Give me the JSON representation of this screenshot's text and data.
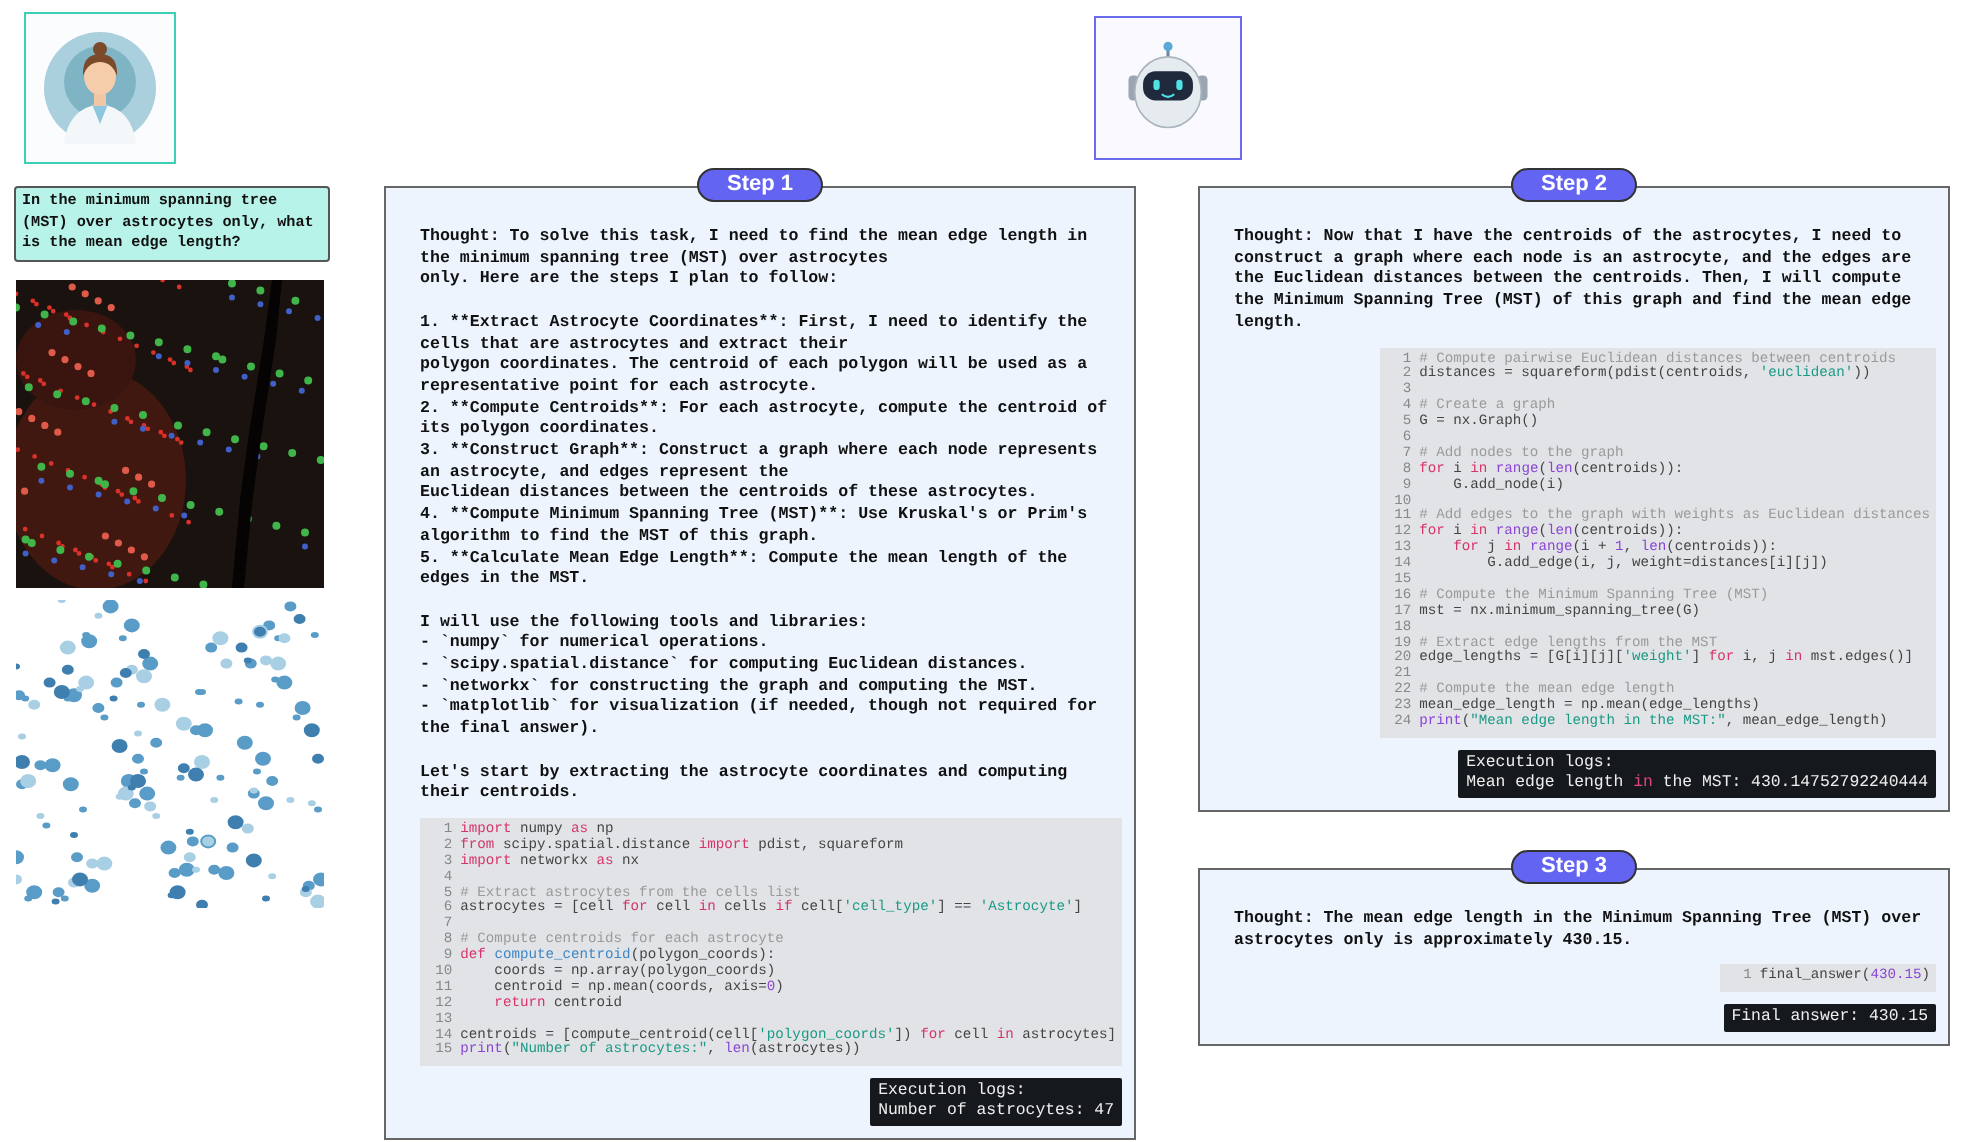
{
  "question": "In the minimum spanning tree (MST) over astrocytes only, what is the mean edge length?",
  "steps": [
    {
      "label": "Step 1",
      "thought": [
        [
          "Thought: To solve this task, I need to find the mean edge length in",
          "the minimum spanning tree (MST) over astrocytes",
          "only. Here are the steps I plan to follow:"
        ],
        [
          "1. **Extract Astrocyte Coordinates**: First, I need to identify the",
          "cells that are astrocytes and extract their",
          "polygon coordinates. The centroid of each polygon will be used as a",
          "representative point for each astrocyte.",
          "2. **Compute Centroids**: For each astrocyte, compute the centroid of",
          "its polygon coordinates.",
          "3. **Construct Graph**: Construct a graph where each node represents",
          "an astrocyte, and edges represent the",
          "Euclidean distances between the centroids of these astrocytes.",
          "4. **Compute Minimum Spanning Tree (MST)**: Use Kruskal's or Prim's",
          "algorithm to find the MST of this graph.",
          "5. **Calculate Mean Edge Length**: Compute the mean length of the",
          "edges in the MST."
        ],
        [
          "I will use the following tools and libraries:",
          "- `numpy` for numerical operations.",
          "- `scipy.spatial.distance` for computing Euclidean distances.",
          "- `networkx` for constructing the graph and computing the MST.",
          "- `matplotlib` for visualization (if needed, though not required for",
          "the final answer)."
        ],
        [
          "Let's start by extracting the astrocyte coordinates and computing",
          "their centroids."
        ]
      ],
      "code": [
        {
          "number": "1",
          "tokens": [
            {
              "text": "import",
              "kind": "keyword"
            },
            {
              "text": " numpy ",
              "kind": "plain"
            },
            {
              "text": "as",
              "kind": "keyword"
            },
            {
              "text": " np",
              "kind": "plain"
            }
          ]
        },
        {
          "number": "2",
          "tokens": [
            {
              "text": "from",
              "kind": "keyword"
            },
            {
              "text": " scipy.spatial.distance ",
              "kind": "plain"
            },
            {
              "text": "import",
              "kind": "keyword"
            },
            {
              "text": " pdist, squareform",
              "kind": "plain"
            }
          ]
        },
        {
          "number": "3",
          "tokens": [
            {
              "text": "import",
              "kind": "keyword"
            },
            {
              "text": " networkx ",
              "kind": "plain"
            },
            {
              "text": "as",
              "kind": "keyword"
            },
            {
              "text": " nx",
              "kind": "plain"
            }
          ]
        },
        {
          "number": "4"
        },
        {
          "number": "5",
          "tokens": [
            {
              "text": "# Extract astrocytes from the cells list",
              "kind": "comment"
            }
          ]
        },
        {
          "number": "6",
          "tokens": [
            {
              "text": "astrocytes = [cell ",
              "kind": "plain"
            },
            {
              "text": "for",
              "kind": "keyword"
            },
            {
              "text": " cell ",
              "kind": "plain"
            },
            {
              "text": "in",
              "kind": "keyword"
            },
            {
              "text": " cells ",
              "kind": "plain"
            },
            {
              "text": "if",
              "kind": "keyword"
            },
            {
              "text": " cell[",
              "kind": "plain"
            },
            {
              "text": "'cell_type'",
              "kind": "string"
            },
            {
              "text": "] == ",
              "kind": "plain"
            },
            {
              "text": "'Astrocyte'",
              "kind": "string"
            },
            {
              "text": "]",
              "kind": "plain"
            }
          ]
        },
        {
          "number": "7"
        },
        {
          "number": "8",
          "tokens": [
            {
              "text": "# Compute centroids for each astrocyte",
              "kind": "comment"
            }
          ]
        },
        {
          "number": "9",
          "tokens": [
            {
              "text": "def ",
              "kind": "keyword"
            },
            {
              "text": "compute_centroid",
              "kind": "function"
            },
            {
              "text": "(polygon_coords):",
              "kind": "plain"
            }
          ]
        },
        {
          "number": "10",
          "tokens": [
            {
              "text": "    coords = np.array(polygon_coords)",
              "kind": "plain"
            }
          ]
        },
        {
          "number": "11",
          "tokens": [
            {
              "text": "    centroid = np.mean(coords, axis=",
              "kind": "plain"
            },
            {
              "text": "0",
              "kind": "number"
            },
            {
              "text": ")",
              "kind": "plain"
            }
          ]
        },
        {
          "number": "12",
          "tokens": [
            {
              "text": "    return",
              "kind": "keyword"
            },
            {
              "text": " centroid",
              "kind": "plain"
            }
          ]
        },
        {
          "number": "13"
        },
        {
          "number": "14",
          "tokens": [
            {
              "text": "centroids = [compute_centroid(cell[",
              "kind": "plain"
            },
            {
              "text": "'polygon_coords'",
              "kind": "string"
            },
            {
              "text": "]) ",
              "kind": "plain"
            },
            {
              "text": "for",
              "kind": "keyword"
            },
            {
              "text": " cell ",
              "kind": "plain"
            },
            {
              "text": "in",
              "kind": "keyword"
            },
            {
              "text": " astrocytes]",
              "kind": "plain"
            }
          ]
        },
        {
          "number": "15",
          "tokens": [
            {
              "text": "print",
              "kind": "builtin"
            },
            {
              "text": "(",
              "kind": "plain"
            },
            {
              "text": "\"Number of astrocytes:\"",
              "kind": "string"
            },
            {
              "text": ", ",
              "kind": "plain"
            },
            {
              "text": "len",
              "kind": "builtin"
            },
            {
              "text": "(astrocytes))",
              "kind": "plain"
            }
          ]
        }
      ],
      "log": [
        [
          {
            "text": "Execution logs:",
            "kind": "plain"
          }
        ],
        [
          {
            "text": "Number of astrocytes: 47",
            "kind": "plain"
          }
        ]
      ]
    },
    {
      "label": "Step 2",
      "thought": [
        [
          "Thought: Now that I have the centroids of the astrocytes, I need to",
          "construct a graph where each node is an astrocyte, and the edges are",
          "the Euclidean distances between the centroids. Then, I will compute",
          "the Minimum Spanning Tree (MST) of this graph and find the mean edge",
          "length."
        ]
      ],
      "code": [
        {
          "number": "1",
          "tokens": [
            {
              "text": "# Compute pairwise Euclidean distances between centroids",
              "kind": "comment"
            }
          ]
        },
        {
          "number": "2",
          "tokens": [
            {
              "text": "distances = squareform(pdist(centroids, ",
              "kind": "plain"
            },
            {
              "text": "'euclidean'",
              "kind": "string"
            },
            {
              "text": "))",
              "kind": "plain"
            }
          ]
        },
        {
          "number": "3"
        },
        {
          "number": "4",
          "tokens": [
            {
              "text": "# Create a graph",
              "kind": "comment"
            }
          ]
        },
        {
          "number": "5",
          "tokens": [
            {
              "text": "G = nx.Graph()",
              "kind": "plain"
            }
          ]
        },
        {
          "number": "6"
        },
        {
          "number": "7",
          "tokens": [
            {
              "text": "# Add nodes to the graph",
              "kind": "comment"
            }
          ]
        },
        {
          "number": "8",
          "tokens": [
            {
              "text": "for",
              "kind": "keyword"
            },
            {
              "text": " i ",
              "kind": "plain"
            },
            {
              "text": "in ",
              "kind": "keyword"
            },
            {
              "text": "range",
              "kind": "builtin"
            },
            {
              "text": "(",
              "kind": "plain"
            },
            {
              "text": "len",
              "kind": "builtin"
            },
            {
              "text": "(centroids)):",
              "kind": "plain"
            }
          ]
        },
        {
          "number": "9",
          "tokens": [
            {
              "text": "    G.add_node(i)",
              "kind": "plain"
            }
          ]
        },
        {
          "number": "10"
        },
        {
          "number": "11",
          "tokens": [
            {
              "text": "# Add edges to the graph with weights as Euclidean distances",
              "kind": "comment"
            }
          ]
        },
        {
          "number": "12",
          "tokens": [
            {
              "text": "for",
              "kind": "keyword"
            },
            {
              "text": " i ",
              "kind": "plain"
            },
            {
              "text": "in ",
              "kind": "keyword"
            },
            {
              "text": "range",
              "kind": "builtin"
            },
            {
              "text": "(",
              "kind": "plain"
            },
            {
              "text": "len",
              "kind": "builtin"
            },
            {
              "text": "(centroids)):",
              "kind": "plain"
            }
          ]
        },
        {
          "number": "13",
          "tokens": [
            {
              "text": "    for",
              "kind": "keyword"
            },
            {
              "text": " j ",
              "kind": "plain"
            },
            {
              "text": "in ",
              "kind": "keyword"
            },
            {
              "text": "range",
              "kind": "builtin"
            },
            {
              "text": "(i + ",
              "kind": "plain"
            },
            {
              "text": "1",
              "kind": "number"
            },
            {
              "text": ", ",
              "kind": "plain"
            },
            {
              "text": "len",
              "kind": "builtin"
            },
            {
              "text": "(centroids)):",
              "kind": "plain"
            }
          ]
        },
        {
          "number": "14",
          "tokens": [
            {
              "text": "        G.add_edge(i, j, weight=distances[i][j])",
              "kind": "plain"
            }
          ]
        },
        {
          "number": "15"
        },
        {
          "number": "16",
          "tokens": [
            {
              "text": "# Compute the Minimum Spanning Tree (MST)",
              "kind": "comment"
            }
          ]
        },
        {
          "number": "17",
          "tokens": [
            {
              "text": "mst = nx.minimum_spanning_tree(G)",
              "kind": "plain"
            }
          ]
        },
        {
          "number": "18"
        },
        {
          "number": "19",
          "tokens": [
            {
              "text": "# Extract edge lengths from the MST",
              "kind": "comment"
            }
          ]
        },
        {
          "number": "20",
          "tokens": [
            {
              "text": "edge_lengths = [G[i][j][",
              "kind": "plain"
            },
            {
              "text": "'weight'",
              "kind": "string"
            },
            {
              "text": "] ",
              "kind": "plain"
            },
            {
              "text": "for",
              "kind": "keyword"
            },
            {
              "text": " i, j ",
              "kind": "plain"
            },
            {
              "text": "in",
              "kind": "keyword"
            },
            {
              "text": " mst.edges()]",
              "kind": "plain"
            }
          ]
        },
        {
          "number": "21"
        },
        {
          "number": "22",
          "tokens": [
            {
              "text": "# Compute the mean edge length",
              "kind": "comment"
            }
          ]
        },
        {
          "number": "23",
          "tokens": [
            {
              "text": "mean_edge_length = np.mean(edge_lengths)",
              "kind": "plain"
            }
          ]
        },
        {
          "number": "24",
          "tokens": [
            {
              "text": "print",
              "kind": "builtin"
            },
            {
              "text": "(",
              "kind": "plain"
            },
            {
              "text": "\"Mean edge length in the MST:\"",
              "kind": "string"
            },
            {
              "text": ", mean_edge_length)",
              "kind": "plain"
            }
          ]
        }
      ],
      "log": [
        [
          {
            "text": "Execution logs:",
            "kind": "plain"
          }
        ],
        [
          {
            "text": "Mean edge length ",
            "kind": "plain"
          },
          {
            "text": "in",
            "kind": "keyword"
          },
          {
            "text": " the MST: 430.14752792240444",
            "kind": "plain"
          }
        ]
      ]
    },
    {
      "label": "Step 3",
      "thought": [
        [
          "Thought: The mean edge length in the Minimum Spanning Tree (MST) over",
          "astrocytes only is approximately 430.15."
        ]
      ],
      "code": [
        {
          "number": "1",
          "tokens": [
            {
              "text": "final_answer(",
              "kind": "plain"
            },
            {
              "text": "430.15",
              "kind": "number"
            },
            {
              "text": ")",
              "kind": "plain"
            }
          ]
        }
      ],
      "log": [
        [
          {
            "text": "Final answer: 430.15",
            "kind": "plain"
          }
        ]
      ]
    }
  ]
}
